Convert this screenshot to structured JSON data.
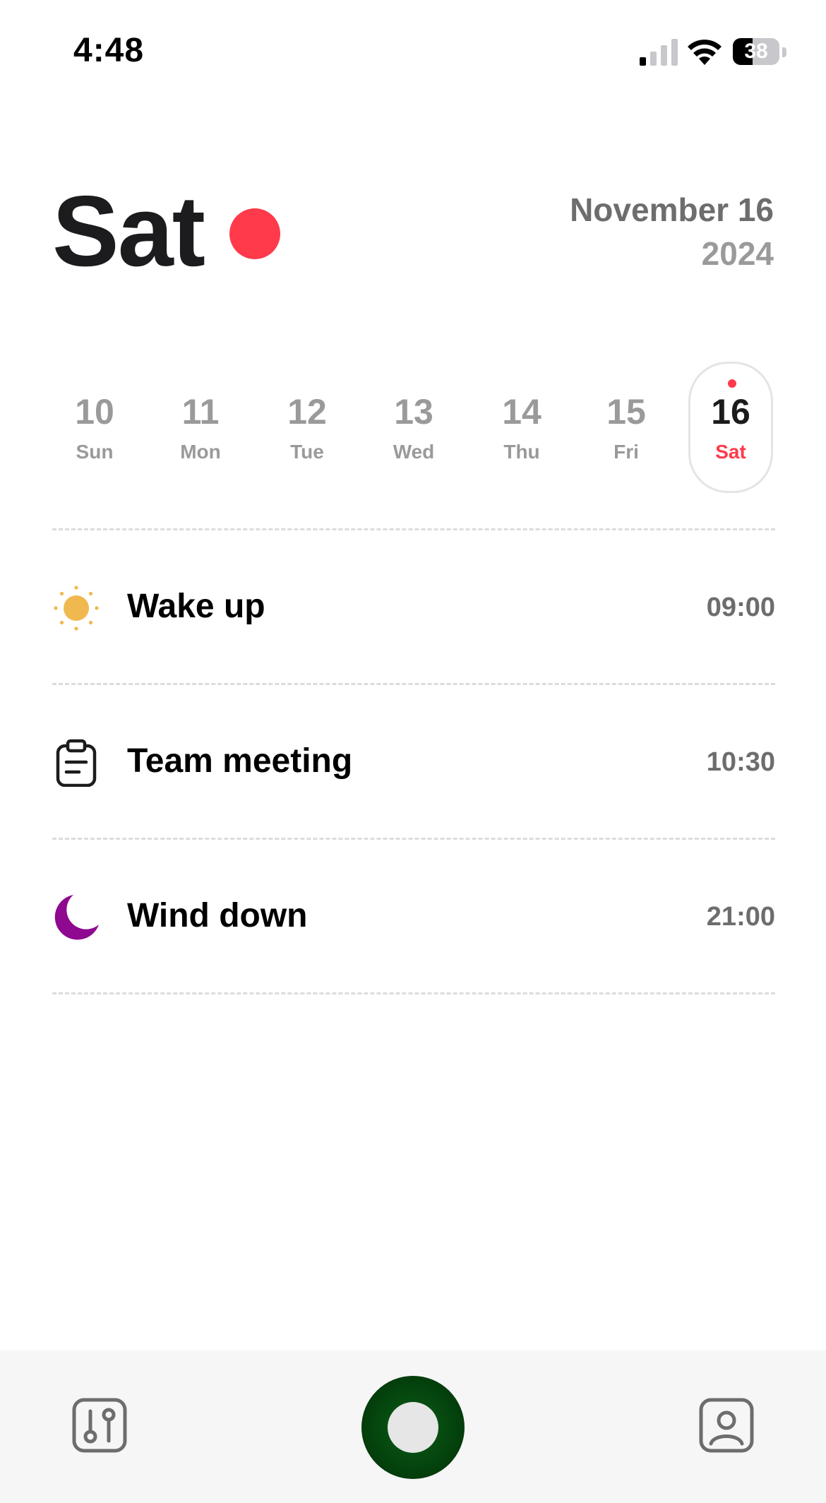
{
  "status_bar": {
    "time": "4:48",
    "battery": "38",
    "signal_icon": "cellular-signal-icon",
    "wifi_icon": "wifi-icon",
    "battery_icon": "battery-icon"
  },
  "header": {
    "day_name": "Sat",
    "month_day": "November 16",
    "year": "2024",
    "today_indicator_color": "#fe3a4b"
  },
  "week": {
    "days": [
      {
        "num": "10",
        "name": "Sun"
      },
      {
        "num": "11",
        "name": "Mon"
      },
      {
        "num": "12",
        "name": "Tue"
      },
      {
        "num": "13",
        "name": "Wed"
      },
      {
        "num": "14",
        "name": "Thu"
      },
      {
        "num": "15",
        "name": "Fri"
      },
      {
        "num": "16",
        "name": "Sat"
      }
    ],
    "selected_index": 6
  },
  "events": [
    {
      "title": "Wake up",
      "time": "09:00",
      "icon": "sun-icon",
      "icon_color": "#f0b94f"
    },
    {
      "title": "Team meeting",
      "time": "10:30",
      "icon": "clipboard-icon",
      "icon_color": "#1c1c1e"
    },
    {
      "title": "Wind down",
      "time": "21:00",
      "icon": "moon-icon",
      "icon_color": "#8e0890"
    }
  ],
  "bottom_bar": {
    "left_icon": "settings-sliders-icon",
    "center_button": "record-button",
    "right_icon": "profile-icon",
    "record_color": "#04420d"
  },
  "colors": {
    "accent": "#fe3a4b",
    "text_primary": "#1c1c1e",
    "text_secondary": "#9a9a9a"
  }
}
